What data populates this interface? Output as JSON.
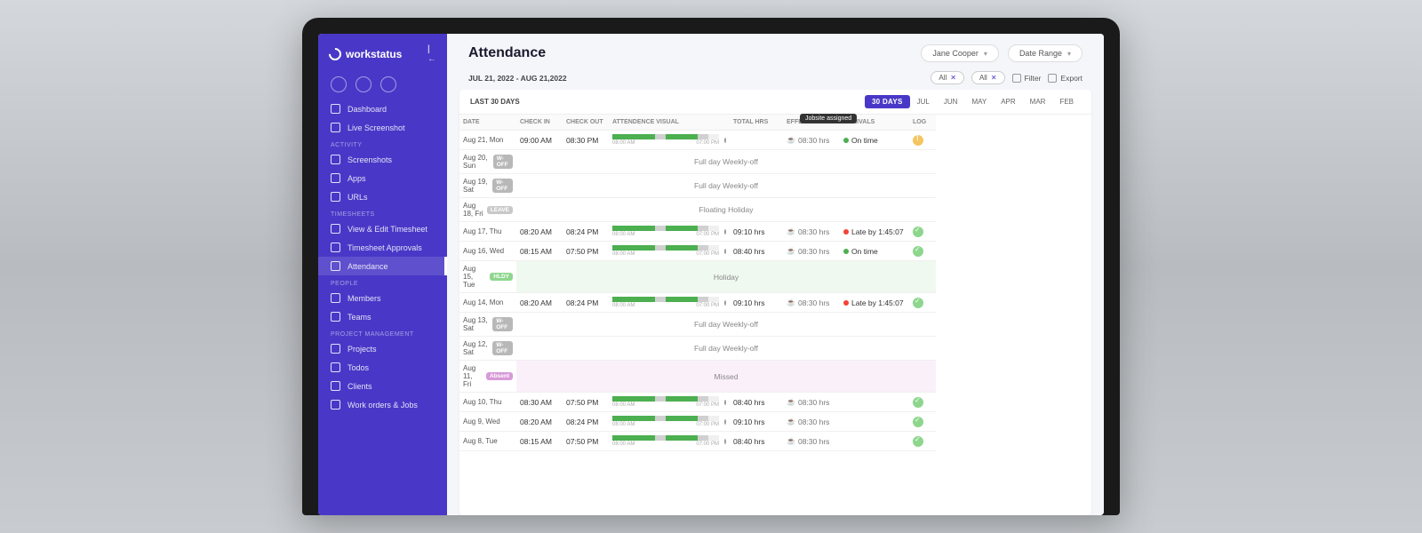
{
  "brand": "workstatus",
  "sidebar": {
    "items": [
      {
        "label": "Dashboard"
      },
      {
        "label": "Live Screenshot"
      }
    ],
    "activity_label": "ACTIVITY",
    "activity": [
      {
        "label": "Screenshots"
      },
      {
        "label": "Apps"
      },
      {
        "label": "URLs"
      }
    ],
    "timesheets_label": "TIMESHEETS",
    "timesheets": [
      {
        "label": "View & Edit Timesheet"
      },
      {
        "label": "Timesheet Approvals"
      },
      {
        "label": "Attendance"
      }
    ],
    "people_label": "PEOPLE",
    "people": [
      {
        "label": "Members"
      },
      {
        "label": "Teams"
      }
    ],
    "pm_label": "PROJECT MANAGEMENT",
    "pm": [
      {
        "label": "Projects"
      },
      {
        "label": "Todos"
      },
      {
        "label": "Clients"
      },
      {
        "label": "Work orders & Jobs"
      }
    ]
  },
  "header": {
    "title": "Attendance",
    "user": "Jane Cooper",
    "range_label": "Date Range"
  },
  "toolbar": {
    "daterange": "JUL 21, 2022 - AUG 21,2022",
    "chip_all_1": "All",
    "chip_all_2": "All",
    "filter": "Filter",
    "export": "Export"
  },
  "table": {
    "last30": "LAST 30 DAYS",
    "tabs": [
      "30 DAYS",
      "JUL",
      "JUN",
      "MAY",
      "APR",
      "MAR",
      "FEB"
    ],
    "columns": {
      "date": "DATE",
      "checkin": "CHECK IN",
      "checkout": "CHECK OUT",
      "visual": "ATTENDENCE VISUAL",
      "total": "TOTAL HRS",
      "effective": "EFFECTIVE HRS",
      "arrivals": "ARRIVALS",
      "log": "LOG"
    },
    "tooltip": "Jobsite assigned",
    "bar_start": "08:00 AM",
    "bar_end": "07:00 PM",
    "rows": [
      {
        "date": "Aug 21, Mon",
        "in": "09:00 AM",
        "out": "08:30 PM",
        "total": "",
        "eff": "08:30 hrs",
        "arr": "On time",
        "arr_dot": "green",
        "log": "warn",
        "vis": 1
      },
      {
        "date": "Aug 20, Sun",
        "badge": "W-OFF",
        "span": "Full day Weekly-off"
      },
      {
        "date": "Aug 19, Sat",
        "badge": "W-OFF",
        "span": "Full day Weekly-off"
      },
      {
        "date": "Aug 18, Fri",
        "badge": "LEAVE",
        "span": "Floating Holiday"
      },
      {
        "date": "Aug 17, Thu",
        "in": "08:20 AM",
        "out": "08:24 PM",
        "total": "09:10 hrs",
        "eff": "08:30 hrs",
        "arr": "Late by 1:45:07",
        "arr_dot": "red",
        "log": "ok",
        "vis": 1
      },
      {
        "date": "Aug 16, Wed",
        "in": "08:15 AM",
        "out": "07:50 PM",
        "total": "08:40 hrs",
        "eff": "08:30 hrs",
        "arr": "On time",
        "arr_dot": "green",
        "log": "ok",
        "vis": 1
      },
      {
        "date": "Aug 15, Tue",
        "badge": "HLDY",
        "span": "Holiday",
        "spanclass": "hl"
      },
      {
        "date": "Aug 14, Mon",
        "in": "08:20 AM",
        "out": "08:24 PM",
        "total": "09:10 hrs",
        "eff": "08:30 hrs",
        "arr": "Late by 1:45:07",
        "arr_dot": "red",
        "log": "ok",
        "vis": 1
      },
      {
        "date": "Aug 13, Sat",
        "badge": "W-OFF",
        "span": "Full day Weekly-off"
      },
      {
        "date": "Aug 12, Sat",
        "badge": "W-OFF",
        "span": "Full day Weekly-off"
      },
      {
        "date": "Aug 11, Fri",
        "badge": "Absent",
        "span": "Missed",
        "spanclass": "ab"
      },
      {
        "date": "Aug 10, Thu",
        "in": "08:30 AM",
        "out": "07:50 PM",
        "total": "08:40 hrs",
        "eff": "08:30 hrs",
        "log": "ok",
        "vis": 1
      },
      {
        "date": "Aug 9, Wed",
        "in": "08:20 AM",
        "out": "08:24 PM",
        "total": "09:10 hrs",
        "eff": "08:30 hrs",
        "log": "ok",
        "vis": 1
      },
      {
        "date": "Aug 8, Tue",
        "in": "08:15 AM",
        "out": "07:50 PM",
        "total": "08:40 hrs",
        "eff": "08:30 hrs",
        "log": "ok",
        "vis": 1
      }
    ]
  }
}
